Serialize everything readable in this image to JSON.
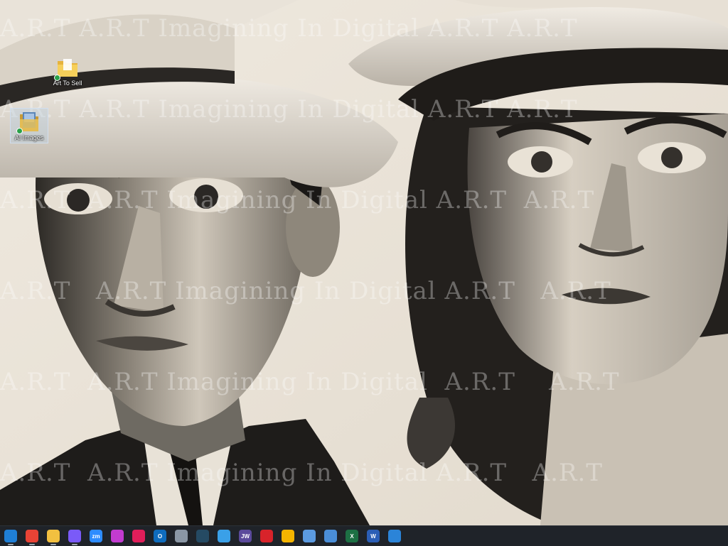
{
  "desktop": {
    "watermark_lines": [
      "A.R.T A.R.T Imagining In Digital A.R.T A.R.T",
      "A.R.T A.R.T Imagining In Digital A.R.T A.R.T",
      "A.R.T  A.R.T Imagining In Digital A.R.T  A.R.T",
      "A.R.T   A.R.T Imagining In Digital A.R.T   A.R.T",
      "A.R.T  A.R.T Imagining In Digital  A.R.T    A.R.T",
      "A.R.T  A.R.T Imagining In Digital A.R.T   A.R.T"
    ],
    "icons": [
      {
        "label": "Art To Sell",
        "icon": "folder-icon"
      },
      {
        "label": "AI Images",
        "icon": "image-folder-icon"
      }
    ]
  },
  "taskbar": {
    "items": [
      {
        "name": "edge",
        "icon": "edge-icon",
        "label": "",
        "color": "#1f7fd6"
      },
      {
        "name": "chrome",
        "icon": "chrome-icon",
        "label": "",
        "color": "#e84335"
      },
      {
        "name": "explorer",
        "icon": "folder-icon",
        "label": "",
        "color": "#f2c040"
      },
      {
        "name": "copilot",
        "icon": "copilot-icon",
        "label": "",
        "color": "#7a5af8"
      },
      {
        "name": "zoom",
        "icon": "zoom-icon",
        "label": "zm",
        "color": "#2d8cff"
      },
      {
        "name": "pinwheel",
        "icon": "pinwheel-icon",
        "label": "",
        "color": "#c23bd0"
      },
      {
        "name": "slack",
        "icon": "slack-icon",
        "label": "",
        "color": "#e01e5a"
      },
      {
        "name": "outlook",
        "icon": "outlook-icon",
        "label": "O",
        "color": "#0f6cbd"
      },
      {
        "name": "files",
        "icon": "files-icon",
        "label": "",
        "color": "#8b97a5"
      },
      {
        "name": "terminal",
        "icon": "terminal-icon",
        "label": "",
        "color": "#254a63"
      },
      {
        "name": "play",
        "icon": "play-icon",
        "label": "",
        "color": "#3aa0e8"
      },
      {
        "name": "jw",
        "icon": "jw-icon",
        "label": "JW",
        "color": "#5b4a9b"
      },
      {
        "name": "acrobat",
        "icon": "pdf-icon",
        "label": "",
        "color": "#d8232a"
      },
      {
        "name": "store",
        "icon": "store-icon",
        "label": "",
        "color": "#f4b400"
      },
      {
        "name": "chat",
        "icon": "chat-icon",
        "label": "",
        "color": "#5b9ae0"
      },
      {
        "name": "photos",
        "icon": "photos-icon",
        "label": "",
        "color": "#4a8ed8"
      },
      {
        "name": "excel",
        "icon": "excel-icon",
        "label": "X",
        "color": "#1d7044"
      },
      {
        "name": "word",
        "icon": "word-icon",
        "label": "W",
        "color": "#2b5eb6"
      },
      {
        "name": "paint",
        "icon": "paint-icon",
        "label": "",
        "color": "#2b84d8"
      }
    ]
  }
}
